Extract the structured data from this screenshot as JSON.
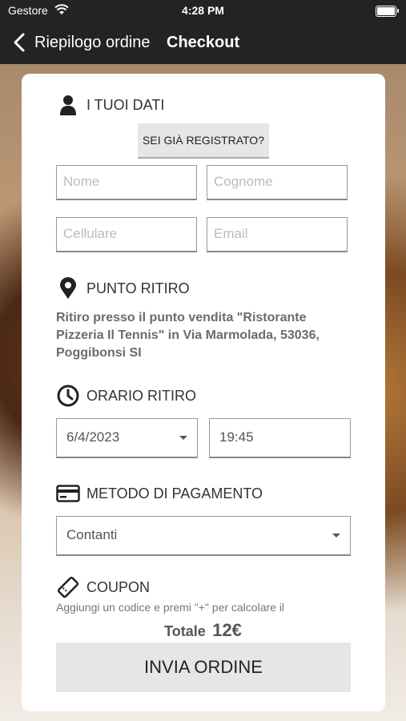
{
  "status_bar": {
    "carrier": "Gestore",
    "time": "4:28 PM"
  },
  "nav": {
    "back_label": "Riepilogo ordine",
    "title": "Checkout"
  },
  "your_data": {
    "heading": "I TUOI DATI",
    "registered_button": "SEI GIÀ REGISTRATO?",
    "first_name_placeholder": "Nome",
    "last_name_placeholder": "Cognome",
    "phone_placeholder": "Cellulare",
    "email_placeholder": "Email"
  },
  "pickup_point": {
    "heading": "PUNTO RITIRO",
    "address": "Ritiro presso il punto vendita \"Ristorante Pizzeria Il Tennis\" in Via Marmolada, 53036, Poggibonsi SI"
  },
  "pickup_time": {
    "heading": "ORARIO RITIRO",
    "date": "6/4/2023",
    "time": "19:45"
  },
  "payment": {
    "heading": "METODO DI PAGAMENTO",
    "selected": "Contanti"
  },
  "coupon": {
    "heading": "COUPON",
    "note": "Aggiungi un codice e premi \"+\" per calcolare il"
  },
  "total": {
    "label": "Totale",
    "value": "12€"
  },
  "submit_label": "INVIA ORDINE"
}
